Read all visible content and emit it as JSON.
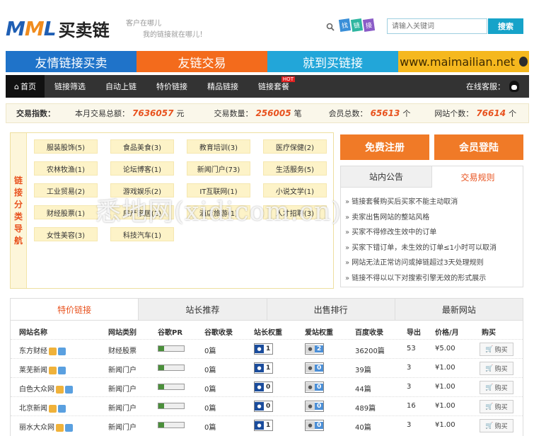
{
  "header": {
    "logo_mml": "MML",
    "logo_cn": "买卖链",
    "slogan_line1": "客户在哪儿",
    "slogan_line2": "我的链接就在哪儿！",
    "hot_words": [
      "找",
      "链",
      "接"
    ],
    "search_placeholder": "请输入关键词",
    "search_button": "搜索"
  },
  "banner": {
    "items": [
      {
        "label": "友情链接买卖",
        "color": "#1f73c9"
      },
      {
        "label": "友链交易",
        "color": "#f36b1c"
      },
      {
        "label": "就到买链接",
        "color": "#22a6d9"
      },
      {
        "label": "www.maimailian.net",
        "color": "#f5b81e"
      }
    ]
  },
  "nav": {
    "items": [
      "首页",
      "链接筛选",
      "自动上链",
      "特价链接",
      "精品链接",
      "链接套餐"
    ],
    "hot_badge": "HOT",
    "service_label": "在线客服："
  },
  "stats": {
    "label": "交易指数：",
    "month_total_label": "本月交易总额：",
    "month_total_value": "7636057",
    "month_total_unit": "元",
    "trade_count_label": "交易数量：",
    "trade_count_value": "256005",
    "trade_count_unit": "笔",
    "members_label": "会员总数：",
    "members_value": "65613",
    "members_unit": "个",
    "sites_label": "网站个数：",
    "sites_value": "76614",
    "sites_unit": "个"
  },
  "categories": {
    "side_label": [
      "链",
      "接",
      "分",
      "类",
      "导",
      "航"
    ],
    "items": [
      "服装股饰(5)",
      "食品美食(3)",
      "教育培训(3)",
      "医疗保健(2)",
      "农林牧渔(1)",
      "论坛博客(1)",
      "新闻门户(73)",
      "生活服务(5)",
      "工业贸易(2)",
      "游戏娱乐(2)",
      "IT互联网(1)",
      "小说文学(1)",
      "财经股票(1)",
      "房产家居(2)",
      "酒店旅游(1)",
      "人才招聘(3)",
      "女性美容(3)",
      "科技汽车(1)"
    ]
  },
  "side_panel": {
    "register": "免费注册",
    "login": "会员登陆",
    "tab1": "站内公告",
    "tab2": "交易规则",
    "rules": [
      "链接套餐购买后买家不能主动取消",
      "卖家出售网站的整站风格",
      "买家不得修改生效中的订单",
      "买家下错订单，未生效的订单≤1小时可以取消",
      "网站无法正常访问或掉链超过3天处理规则",
      "链接不得以以下对搜索引擎无效的形式展示"
    ]
  },
  "watermark": "悉地网(xidicom.cn)",
  "bottom_tabs": [
    "特价链接",
    "站长推荐",
    "出售排行",
    "最新网站"
  ],
  "table": {
    "headers": [
      "网站名称",
      "网站类别",
      "谷歌PR",
      "谷歌收录",
      "站长权重",
      "爱站权重",
      "百度收录",
      "导出",
      "价格/月",
      "购买"
    ],
    "rows": [
      {
        "name": "东方财经",
        "category": "财经股票",
        "google_index": "0篇",
        "zz_weight": "1",
        "az_weight": "2",
        "baidu": "36200篇",
        "out": "53",
        "price": "¥5.00",
        "buy": "购买"
      },
      {
        "name": "莱芜新闻",
        "category": "新闻门户",
        "google_index": "0篇",
        "zz_weight": "1",
        "az_weight": "0",
        "baidu": "39篇",
        "out": "3",
        "price": "¥1.00",
        "buy": "购买"
      },
      {
        "name": "白色大众网",
        "category": "新闻门户",
        "google_index": "0篇",
        "zz_weight": "0",
        "az_weight": "0",
        "baidu": "44篇",
        "out": "3",
        "price": "¥1.00",
        "buy": "购买"
      },
      {
        "name": "北京新闻",
        "category": "新闻门户",
        "google_index": "0篇",
        "zz_weight": "0",
        "az_weight": "0",
        "baidu": "489篇",
        "out": "16",
        "price": "¥1.00",
        "buy": "购买"
      },
      {
        "name": "丽水大众网",
        "category": "新闻门户",
        "google_index": "0篇",
        "zz_weight": "1",
        "az_weight": "0",
        "baidu": "40篇",
        "out": "3",
        "price": "¥1.00",
        "buy": "购买"
      }
    ]
  }
}
